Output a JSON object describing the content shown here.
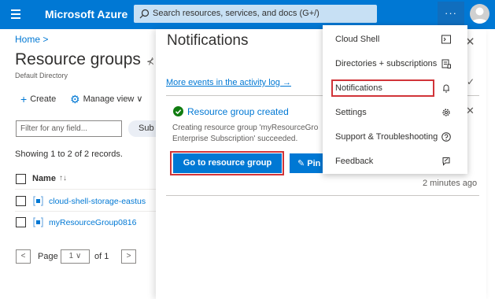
{
  "topbar": {
    "brand": "Microsoft Azure",
    "search_placeholder": "Search resources, services, and docs (G+/)",
    "more_label": "···",
    "accent": "#0078d4"
  },
  "left": {
    "breadcrumb": "Home  >",
    "title": "Resource groups",
    "pin_glyph": "⊀",
    "subtitle": "Default Directory",
    "commands": [
      {
        "icon": "plus-icon",
        "glyph": "+",
        "label": "Create"
      },
      {
        "icon": "gear-icon",
        "glyph": "⚙",
        "label": "Manage view  ∨"
      }
    ],
    "filter_placeholder": "Filter for any field...",
    "subscription_button": "Sub",
    "records": "Showing 1 to 2 of 2 records.",
    "column_name": "Name",
    "sort_glyph": "↑↓",
    "rows": [
      {
        "name": "cloud-shell-storage-eastus"
      },
      {
        "name": "myResourceGroup0816"
      }
    ],
    "pagination": {
      "prev": "<",
      "page_label": "Page",
      "page_value": "1  ∨",
      "of_label": "of 1",
      "next": ">"
    }
  },
  "notifications": {
    "title": "Notifications",
    "close_glyph": "✕",
    "activity_link": "More events in the activity log →",
    "expand_glyph": "✓",
    "item": {
      "heading": "Resource group created",
      "body": "Creating resource group 'myResourceGro\nEnterprise Subscription' succeeded.",
      "primary_action": "Go to resource group",
      "secondary_action": "Pin",
      "secondary_glyph": "✎",
      "time": "2 minutes ago",
      "close_glyph": "✕"
    }
  },
  "menu": {
    "items": [
      {
        "label": "Cloud Shell",
        "icon": "terminal-icon"
      },
      {
        "label": "Directories + subscriptions",
        "icon": "directory-icon"
      },
      {
        "label": "Notifications",
        "icon": "bell-icon",
        "highlighted": true
      },
      {
        "label": "Settings",
        "icon": "gear-icon"
      },
      {
        "label": "Support & Troubleshooting",
        "icon": "question-icon"
      },
      {
        "label": "Feedback",
        "icon": "feedback-icon"
      }
    ]
  },
  "colors": {
    "link": "#0078d4",
    "success": "#107c10",
    "highlight": "#d13438"
  }
}
